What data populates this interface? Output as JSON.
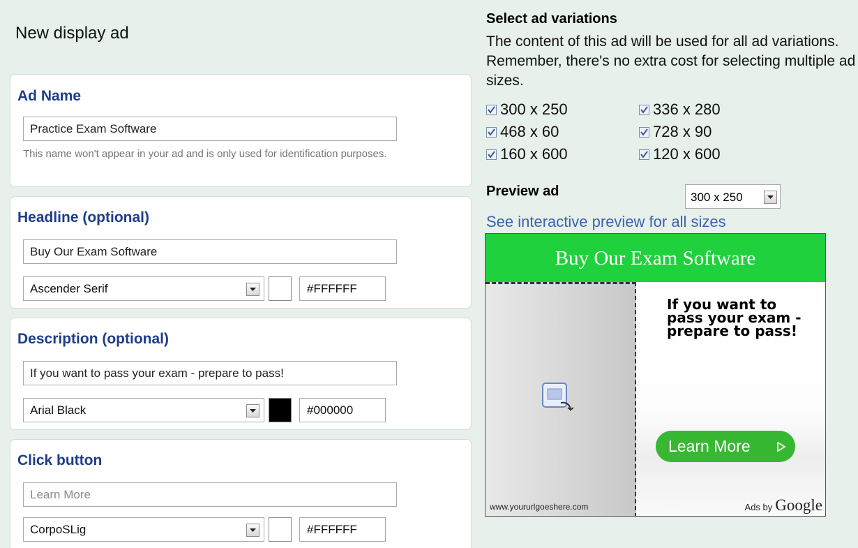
{
  "page": {
    "title": "New display ad"
  },
  "ad_name": {
    "heading": "Ad Name",
    "value": "Practice Exam Software",
    "helper": "This name won't appear in your ad and is only used for identification purposes."
  },
  "headline": {
    "heading": "Headline (optional)",
    "value": "Buy Our Exam Software",
    "font": "Ascender Serif",
    "color_hex": "#FFFFFF",
    "swatch": "#ffffff"
  },
  "description": {
    "heading": "Description (optional)",
    "value": "If you want to pass your exam - prepare to pass!",
    "font": "Arial Black",
    "color_hex": "#000000",
    "swatch": "#000000"
  },
  "click_button": {
    "heading": "Click button",
    "placeholder": "Learn More",
    "font": "CorpoSLig",
    "color_hex": "#FFFFFF",
    "swatch": "#ffffff"
  },
  "variations": {
    "title": "Select ad variations",
    "description": "The content of this ad will be used for all ad variations. Remember, there's no extra cost for selecting multiple ad sizes.",
    "sizes": [
      {
        "label": "300 x 250",
        "checked": true
      },
      {
        "label": "336 x 280",
        "checked": true
      },
      {
        "label": "468 x 60",
        "checked": true
      },
      {
        "label": "728 x 90",
        "checked": true
      },
      {
        "label": "160 x 600",
        "checked": true
      },
      {
        "label": "120 x 600",
        "checked": true
      }
    ]
  },
  "preview": {
    "label": "Preview ad",
    "size": "300 x 250",
    "link": "See interactive preview for all sizes"
  },
  "ad": {
    "headline": "Buy Our Exam Software",
    "description": "If you want to pass your exam - prepare to pass!",
    "button": "Learn More",
    "url": "www.yoururlgoeshere.com",
    "ads_by": "Ads by",
    "google": "Google",
    "head_color": "#1fd13c",
    "button_color": "#38b832"
  }
}
